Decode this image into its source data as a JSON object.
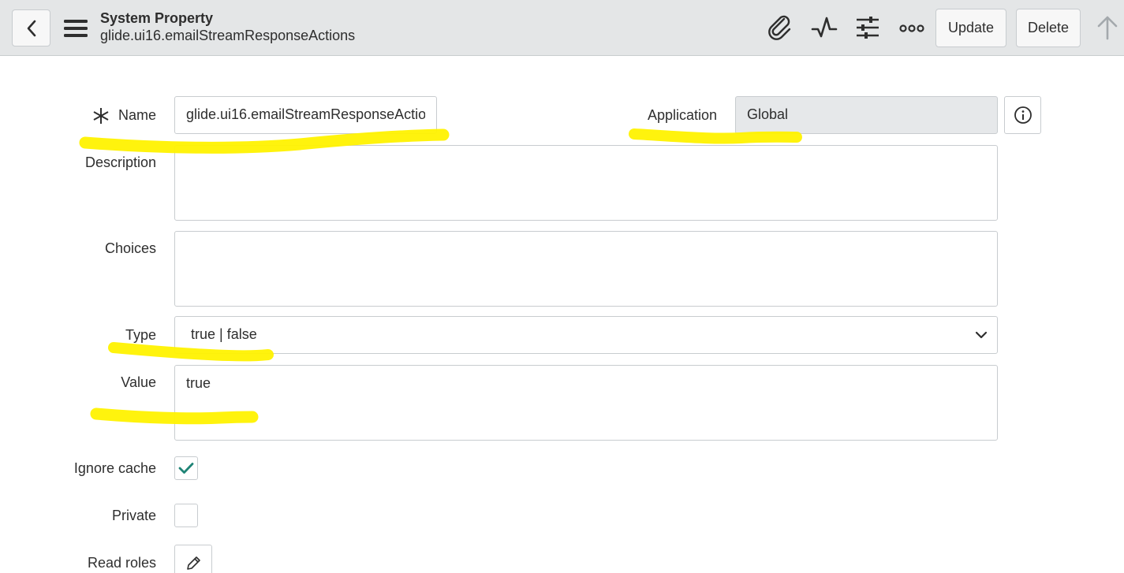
{
  "header": {
    "title": "System Property",
    "subtitle": "glide.ui16.emailStreamResponseActions",
    "update_label": "Update",
    "delete_label": "Delete"
  },
  "form": {
    "name": {
      "label": "Name",
      "value": "glide.ui16.emailStreamResponseActions",
      "required": true
    },
    "application": {
      "label": "Application",
      "value": "Global"
    },
    "description": {
      "label": "Description",
      "value": ""
    },
    "choices": {
      "label": "Choices",
      "value": ""
    },
    "type": {
      "label": "Type",
      "value": "true | false"
    },
    "value": {
      "label": "Value",
      "value": "true"
    },
    "ignore_cache": {
      "label": "Ignore cache",
      "checked": true
    },
    "private": {
      "label": "Private",
      "checked": false
    },
    "read_roles": {
      "label": "Read roles"
    }
  },
  "colors": {
    "header_bg": "#e4e6e7",
    "highlight": "#fff200",
    "check": "#1f8476"
  }
}
